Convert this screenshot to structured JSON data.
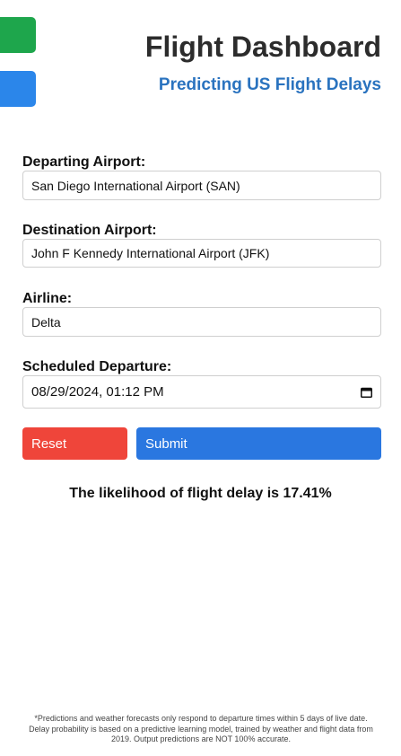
{
  "colors": {
    "green_tab": "#1ea64c",
    "blue_tab": "#2b86ea",
    "subtitle": "#2a73bf",
    "reset": "#ef453a",
    "submit": "#2a77e0"
  },
  "header": {
    "title": "Flight Dashboard",
    "subtitle": "Predicting US Flight Delays"
  },
  "form": {
    "departing": {
      "label": "Departing Airport:",
      "value": "San Diego International Airport (SAN)"
    },
    "destination": {
      "label": "Destination Airport:",
      "value": "John F Kennedy International Airport (JFK)"
    },
    "airline": {
      "label": "Airline:",
      "value": "Delta"
    },
    "departure": {
      "label": "Scheduled Departure:",
      "value": "08/29/2024, 01:12 PM",
      "icon": "calendar-icon"
    }
  },
  "buttons": {
    "reset": "Reset",
    "submit": "Submit"
  },
  "result": "The likelihood of flight delay is 17.41%",
  "disclaimer": "*Predictions and weather forecasts only respond to departure times within 5 days of live date. Delay probability is based on a predictive learning model, trained by weather and flight data from 2019. Output predictions are NOT 100% accurate."
}
